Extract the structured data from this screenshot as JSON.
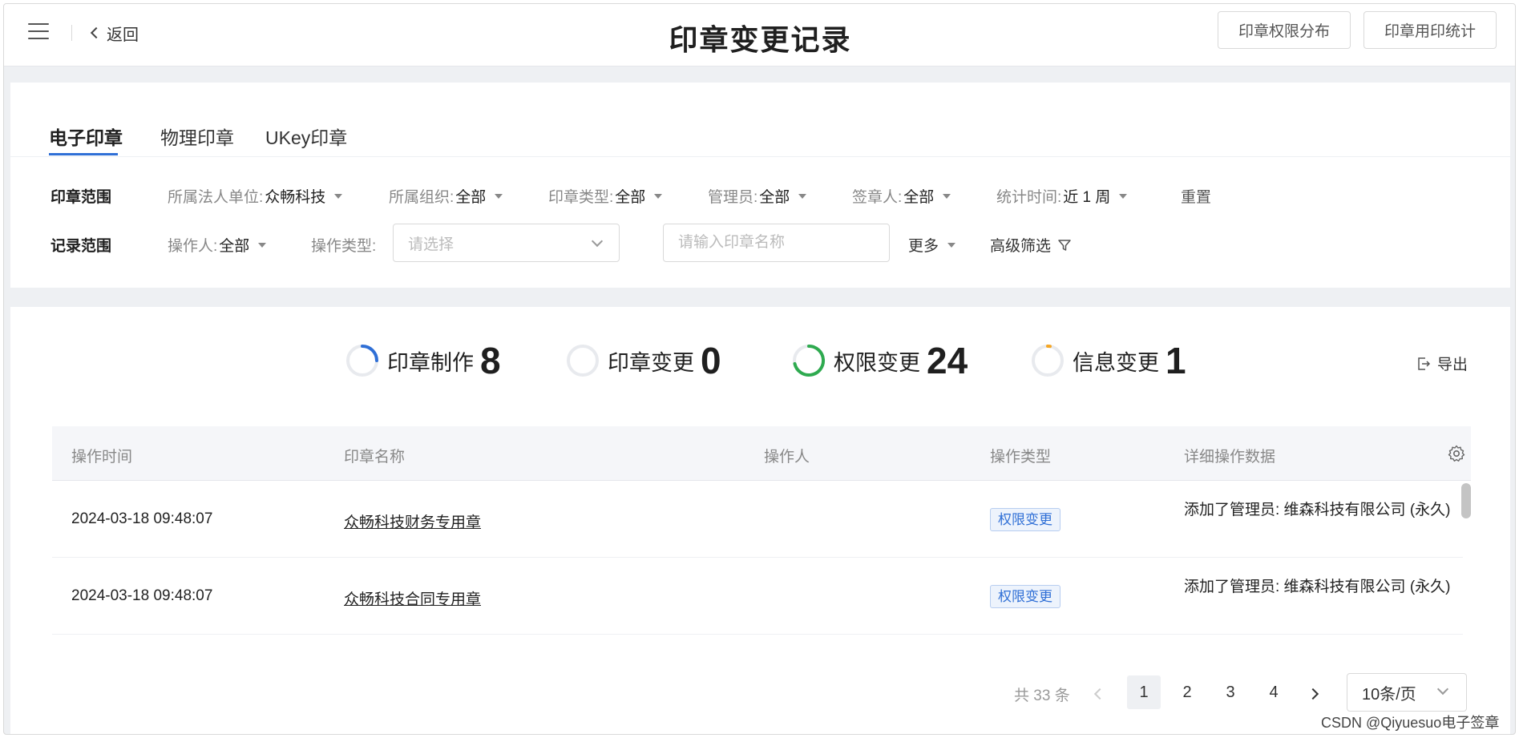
{
  "header": {
    "back_label": "返回",
    "title": "印章变更记录",
    "btn_permission": "印章权限分布",
    "btn_usage_stats": "印章用印统计"
  },
  "tabs": [
    {
      "label": "电子印章",
      "active": true
    },
    {
      "label": "物理印章",
      "active": false
    },
    {
      "label": "UKey印章",
      "active": false
    }
  ],
  "filters": {
    "seal_scope_label": "印章范围",
    "legal_unit": {
      "label": "所属法人单位:",
      "value": "众畅科技"
    },
    "org": {
      "label": "所属组织:",
      "value": "全部"
    },
    "seal_type": {
      "label": "印章类型:",
      "value": "全部"
    },
    "admin": {
      "label": "管理员:",
      "value": "全部"
    },
    "signer": {
      "label": "签章人:",
      "value": "全部"
    },
    "stat_time": {
      "label": "统计时间:",
      "value": "近 1 周"
    },
    "reset": "重置",
    "record_scope_label": "记录范围",
    "operator": {
      "label": "操作人:",
      "value": "全部"
    },
    "op_type_label": "操作类型:",
    "op_type_placeholder": "请选择",
    "seal_name_placeholder": "请输入印章名称",
    "more": "更多",
    "advanced": "高级筛选"
  },
  "stats": [
    {
      "label": "印章制作",
      "value": "8",
      "color": "#2f6fd6"
    },
    {
      "label": "印章变更",
      "value": "0",
      "color": "#cccccc"
    },
    {
      "label": "权限变更",
      "value": "24",
      "color": "#2eaa4f"
    },
    {
      "label": "信息变更",
      "value": "1",
      "color": "#f5a623"
    }
  ],
  "export_label": "导出",
  "table": {
    "headers": [
      "操作时间",
      "印章名称",
      "操作人",
      "操作类型",
      "详细操作数据"
    ],
    "rows": [
      {
        "time": "2024-03-18 09:48:07",
        "name": "众畅科技财务专用章",
        "operator": "",
        "type": "权限变更",
        "detail": "添加了管理员: 维森科技有限公司 (永久)"
      },
      {
        "time": "2024-03-18 09:48:07",
        "name": "众畅科技合同专用章",
        "operator": "",
        "type": "权限变更",
        "detail": "添加了管理员: 维森科技有限公司 (永久)"
      }
    ]
  },
  "pagination": {
    "total": "共 33 条",
    "pages": [
      "1",
      "2",
      "3",
      "4"
    ],
    "current": "1",
    "page_size": "10条/页"
  },
  "watermark": "CSDN @Qiyuesuo电子签章"
}
